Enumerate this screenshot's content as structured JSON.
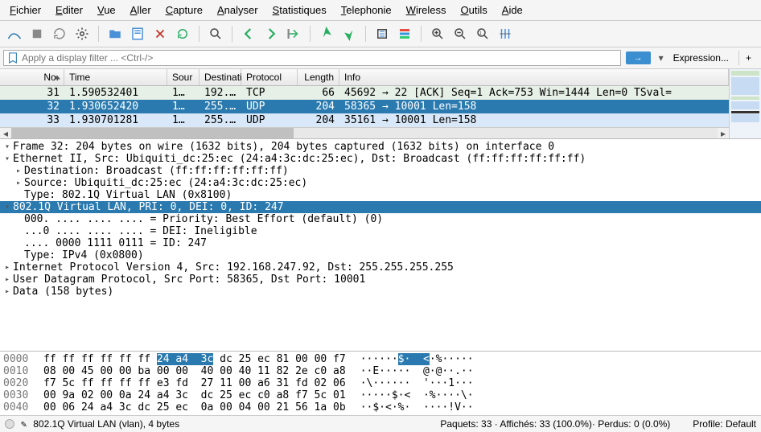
{
  "menu": {
    "items": [
      "Fichier",
      "Editer",
      "Vue",
      "Aller",
      "Capture",
      "Analyser",
      "Statistiques",
      "Telephonie",
      "Wireless",
      "Outils",
      "Aide"
    ],
    "underline_index": [
      0,
      0,
      0,
      0,
      0,
      0,
      0,
      0,
      0,
      0,
      0
    ]
  },
  "toolbar_icons": [
    "fin-icon",
    "stop-icon",
    "reload-icon",
    "gear-icon",
    "sep",
    "open-icon",
    "save-icon",
    "close-icon",
    "restart-icon",
    "sep",
    "find-icon",
    "sep",
    "back-icon",
    "forward-icon",
    "goto-icon",
    "sep",
    "first-icon",
    "last-icon",
    "sep",
    "autoscroll-icon",
    "colorize-icon",
    "sep",
    "zoom-in-icon",
    "zoom-out-icon",
    "zoom-reset-icon",
    "resize-cols-icon"
  ],
  "filter": {
    "placeholder": "Apply a display filter ... <Ctrl-/>",
    "go_label": "→",
    "expr_label": "Expression...",
    "plus_label": "+"
  },
  "packet_columns": [
    "No.",
    "Time",
    "Sour",
    "Destinati",
    "Protocol",
    "Length",
    "Info"
  ],
  "packets": [
    {
      "no": "31",
      "time": "1.590532401",
      "src": "1…",
      "dst": "192.…",
      "proto": "TCP",
      "len": "66",
      "info": "45692 → 22 [ACK] Seq=1 Ack=753 Win=1444 Len=0 TSval=",
      "cls": "row-tcp"
    },
    {
      "no": "32",
      "time": "1.930652420",
      "src": "1…",
      "dst": "255.…",
      "proto": "UDP",
      "len": "204",
      "info": "58365 → 10001 Len=158",
      "cls": "row-sel"
    },
    {
      "no": "33",
      "time": "1.930701281",
      "src": "1…",
      "dst": "255.…",
      "proto": "UDP",
      "len": "204",
      "info": "35161 → 10001 Len=158",
      "cls": "row-udp"
    }
  ],
  "details": [
    {
      "exp": "▾",
      "ind": "",
      "sel": false,
      "text": "Frame 32: 204 bytes on wire (1632 bits), 204 bytes captured (1632 bits) on interface 0"
    },
    {
      "exp": "▾",
      "ind": "",
      "sel": false,
      "text": "Ethernet II, Src: Ubiquiti_dc:25:ec (24:a4:3c:dc:25:ec), Dst: Broadcast (ff:ff:ff:ff:ff:ff)"
    },
    {
      "exp": "▸",
      "ind": "indent1",
      "sel": false,
      "text": "Destination: Broadcast (ff:ff:ff:ff:ff:ff)"
    },
    {
      "exp": "▸",
      "ind": "indent1",
      "sel": false,
      "text": "Source: Ubiquiti_dc:25:ec (24:a4:3c:dc:25:ec)"
    },
    {
      "exp": "",
      "ind": "indent1",
      "sel": false,
      "text": "Type: 802.1Q Virtual LAN (0x8100)"
    },
    {
      "exp": "▾",
      "ind": "",
      "sel": true,
      "text": "802.1Q Virtual LAN, PRI: 0, DEI: 0, ID: 247"
    },
    {
      "exp": "",
      "ind": "indent1",
      "sel": false,
      "text": "000. .... .... .... = Priority: Best Effort (default) (0)"
    },
    {
      "exp": "",
      "ind": "indent1",
      "sel": false,
      "text": "...0 .... .... .... = DEI: Ineligible"
    },
    {
      "exp": "",
      "ind": "indent1",
      "sel": false,
      "text": ".... 0000 1111 0111 = ID: 247"
    },
    {
      "exp": "",
      "ind": "indent1",
      "sel": false,
      "text": "Type: IPv4 (0x0800)"
    },
    {
      "exp": "▸",
      "ind": "",
      "sel": false,
      "text": "Internet Protocol Version 4, Src: 192.168.247.92, Dst: 255.255.255.255"
    },
    {
      "exp": "▸",
      "ind": "",
      "sel": false,
      "text": "User Datagram Protocol, Src Port: 58365, Dst Port: 10001"
    },
    {
      "exp": "▸",
      "ind": "",
      "sel": false,
      "text": "Data (158 bytes)"
    }
  ],
  "hex": [
    {
      "off": "0000",
      "b": "ff ff ff ff ff ff ",
      "hl": "24 a4  3c",
      "a": " dc 25 ec 81 00 00 f7",
      "asc": "······",
      "ahl": "$·  <",
      "aasc": "·%·····"
    },
    {
      "off": "0010",
      "b": "08 00 45 00 00 ba 00 00  40 00 40 11 82 2e c0 a8",
      "asc": "··E·····  @·@··.··"
    },
    {
      "off": "0020",
      "b": "f7 5c ff ff ff ff e3 fd  27 11 00 a6 31 fd 02 06",
      "asc": "·\\······  '···1···"
    },
    {
      "off": "0030",
      "b": "00 9a 02 00 0a 24 a4 3c  dc 25 ec c0 a8 f7 5c 01",
      "asc": "·····$·<  ·%····\\·"
    },
    {
      "off": "0040",
      "b": "00 06 24 a4 3c dc 25 ec  0a 00 04 00 21 56 1a 0b",
      "asc": "··$·<·%·  ····!V··"
    }
  ],
  "status": {
    "left": "802.1Q Virtual LAN (vlan), 4 bytes",
    "mid": "Paquets: 33 · Affichés: 33 (100.0%)· Perdus: 0 (0.0%)",
    "right": "Profile: Default"
  }
}
